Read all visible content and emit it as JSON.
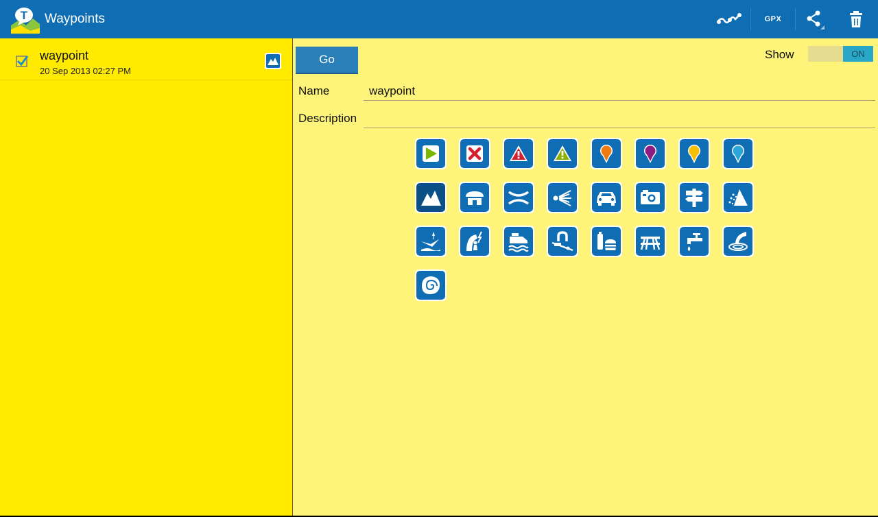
{
  "app": {
    "title": "Waypoints",
    "colors": {
      "bar": "#0f6db3",
      "left_panel": "#ffea00",
      "right_panel": "#fff47a",
      "icon_bg": "#0f6db3"
    }
  },
  "actions": {
    "track_icon": "track-icon",
    "gpx_label": "GPX",
    "share_icon": "share-icon",
    "delete_icon": "trash-icon"
  },
  "waypoints": [
    {
      "name": "waypoint",
      "date": "20 Sep 2013 02:27 PM",
      "checked": true,
      "type_icon": "mountain-icon"
    }
  ],
  "detail": {
    "go_label": "Go",
    "show_label": "Show",
    "show_toggle": "ON",
    "name_label": "Name",
    "name_value": "waypoint",
    "description_label": "Description",
    "description_value": ""
  },
  "icon_options": [
    "play-icon",
    "cross-icon",
    "warning-red-icon",
    "warning-green-icon",
    "pin-orange-icon",
    "pin-purple-icon",
    "pin-yellow-icon",
    "pin-blue-icon",
    "mountain-icon",
    "shelter-icon",
    "pass-icon",
    "viewpoint-icon",
    "car-icon",
    "camera-icon",
    "signpost-icon",
    "scree-icon",
    "paraglide-icon",
    "climbing-icon",
    "ferry-icon",
    "cable-car-icon",
    "food-icon",
    "picnic-icon",
    "water-tap-icon",
    "waterfall-icon",
    "fossil-icon"
  ],
  "selected_icon": "mountain-icon"
}
